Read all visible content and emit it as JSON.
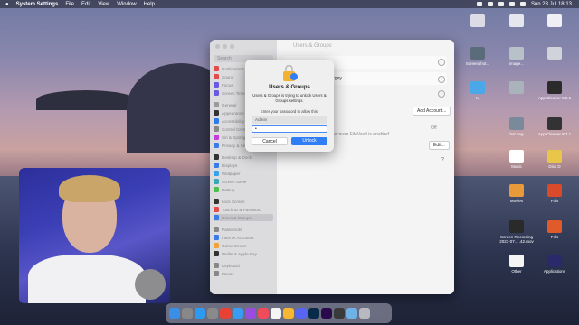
{
  "menubar": {
    "app": "System Settings",
    "items": [
      "File",
      "Edit",
      "View",
      "Window",
      "Help"
    ],
    "clock": "Sun 23 Jul 18:13"
  },
  "window": {
    "title": "Users & Groups",
    "search_placeholder": "Search",
    "sidebar": [
      "Notifications",
      "Sound",
      "Focus",
      "Screen Time",
      "General",
      "Appearance",
      "Accessibility",
      "Control Centre",
      "Siri & Spotlight",
      "Privacy & Security",
      "Desktop & Dock",
      "Displays",
      "Wallpaper",
      "Screen Saver",
      "Battery",
      "Lock Screen",
      "Touch ID & Password",
      "Users & Groups",
      "Passwords",
      "Internet Accounts",
      "Game Center",
      "Wallet & Apple Pay",
      "Keyboard",
      "Mouse"
    ],
    "user_name": "Skakun Sergey",
    "add_account": "Add Account...",
    "note": "turned on because FileVault is enabled.",
    "server_label": "rver",
    "edit_label": "Edit...",
    "off_label": "Off",
    "es_label": "es",
    "help": "?"
  },
  "dialog": {
    "title": "Users & Groups",
    "message": "Users & Groups is trying to unlock Users & Groups settings.",
    "prompt": "Enter your password to allow this.",
    "username": "Admin",
    "password_value": "•",
    "cancel": "Cancel",
    "unlock": "Unlock"
  },
  "desktop_icons": [
    {
      "label": "",
      "color": "#dcdce6"
    },
    {
      "label": "",
      "color": "#e6e6ee"
    },
    {
      "label": "",
      "color": "#f0f0f4"
    },
    {
      "label": "Screenshot...",
      "color": "#5a6c7a"
    },
    {
      "label": "image...",
      "color": "#b8c0c8"
    },
    {
      "label": "",
      "color": "#d0d4da"
    },
    {
      "label": "tv",
      "color": "#4aa8e8"
    },
    {
      "label": "",
      "color": "#aab2bc"
    },
    {
      "label": "App Cleaner 8.2.1",
      "color": "#2b2b2b"
    },
    {
      "label": "bat.png",
      "color": "#7a8a9a"
    },
    {
      "label": "App Cleaner 8.2.1",
      "color": "#333"
    },
    {
      "label": "image...",
      "color": "#8898a8"
    },
    {
      "label": "Music",
      "color": "#ffffff"
    },
    {
      "label": "Disk D",
      "color": "#e8c64a"
    },
    {
      "label": "Movies",
      "color": "#e89a3a"
    },
    {
      "label": "Fols",
      "color": "#d84a2a"
    },
    {
      "label": "Screen Recording 2023-07... .42.mov",
      "color": "#2a2a2a"
    },
    {
      "label": "Fols",
      "color": "#e05a2a"
    },
    {
      "label": "Other",
      "color": "#f4f4f4"
    },
    {
      "label": "Applications",
      "color": "#2a2a6a"
    }
  ],
  "dock_apps": [
    {
      "name": "finder-icon",
      "color": "#3a8ee6"
    },
    {
      "name": "launchpad-icon",
      "color": "#888"
    },
    {
      "name": "safari-icon",
      "color": "#2b9af3"
    },
    {
      "name": "settings-icon",
      "color": "#8a8a8a"
    },
    {
      "name": "chrome-icon",
      "color": "#e94235"
    },
    {
      "name": "appstore-icon",
      "color": "#3a9bf3"
    },
    {
      "name": "podcasts-icon",
      "color": "#9a4be0"
    },
    {
      "name": "music-icon",
      "color": "#f04b5b"
    },
    {
      "name": "notion-icon",
      "color": "#f4f4f4"
    },
    {
      "name": "photos-icon",
      "color": "#f7b733"
    },
    {
      "name": "discord-icon",
      "color": "#5865f2"
    },
    {
      "name": "photoshop-icon",
      "color": "#0a2a4a"
    },
    {
      "name": "premiere-icon",
      "color": "#2a0a4a"
    },
    {
      "name": "screenshot-icon",
      "color": "#3a3a3a"
    },
    {
      "name": "folder-icon",
      "color": "#6fb2e8"
    },
    {
      "name": "trash-icon",
      "color": "#b8b8c0"
    }
  ]
}
